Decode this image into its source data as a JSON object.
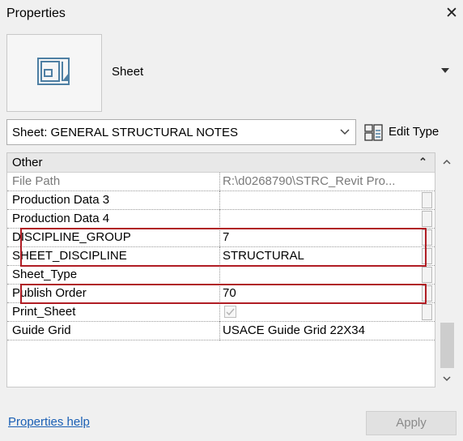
{
  "window": {
    "title": "Properties",
    "close_glyph": "✕"
  },
  "type_selector": {
    "name": "Sheet",
    "icon": "sheet-icon"
  },
  "instance_selector": {
    "value": "Sheet: GENERAL STRUCTURAL NOTES"
  },
  "edit_type": {
    "label": "Edit Type",
    "icon": "edit-type-icon"
  },
  "grid": {
    "group_label": "Other",
    "rows": [
      {
        "name": "File Path",
        "value": "R:\\d0268790\\STRC_Revit Pro...",
        "readonly": true
      },
      {
        "name": "Production Data 3",
        "value": ""
      },
      {
        "name": "Production Data 4",
        "value": ""
      },
      {
        "name": "DISCIPLINE_GROUP",
        "value": "7",
        "highlighted": true
      },
      {
        "name": "SHEET_DISCIPLINE",
        "value": "STRUCTURAL",
        "highlighted": true
      },
      {
        "name": "Sheet_Type",
        "value": ""
      },
      {
        "name": "Publish Order",
        "value": "70",
        "highlighted": true
      },
      {
        "name": "Print_Sheet",
        "value": "",
        "checkbox": true,
        "checked": true
      },
      {
        "name": "Guide Grid",
        "value": "USACE Guide Grid 22X34"
      }
    ]
  },
  "footer": {
    "help_link": "Properties help",
    "apply_label": "Apply"
  },
  "colors": {
    "highlight": "#b01d24",
    "link": "#1a5fb4"
  }
}
